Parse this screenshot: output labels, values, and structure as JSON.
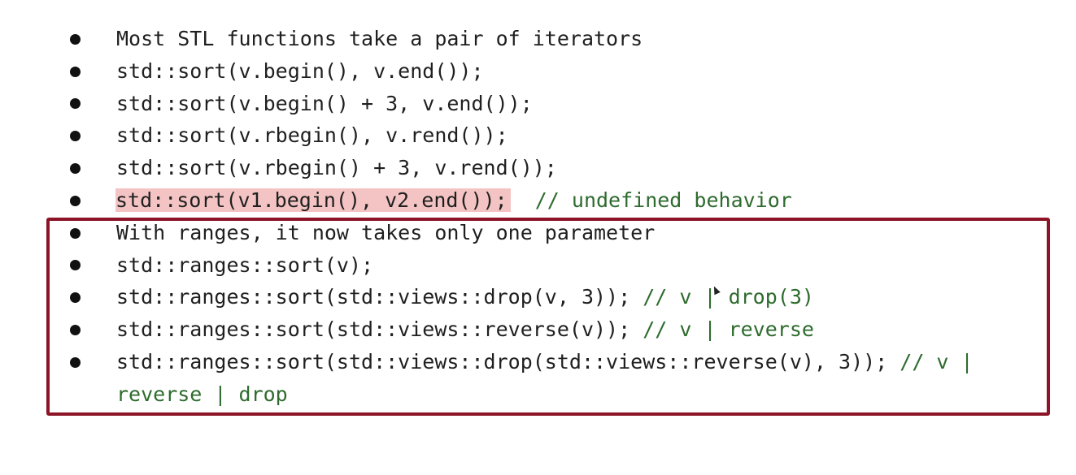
{
  "slide": {
    "lines": [
      {
        "code": "Most STL functions take a pair of iterators",
        "comment": ""
      },
      {
        "code": "std::sort(v.begin(), v.end());",
        "comment": ""
      },
      {
        "code": "std::sort(v.begin() + 3, v.end());",
        "comment": ""
      },
      {
        "code": "std::sort(v.rbegin(), v.rend());",
        "comment": ""
      },
      {
        "code": "std::sort(v.rbegin() + 3, v.rend());",
        "comment": ""
      },
      {
        "code": "std::sort(v1.begin(), v2.end());",
        "comment": "  // undefined behavior"
      },
      {
        "code": "With ranges, it now takes only one parameter",
        "comment": ""
      },
      {
        "code": "std::ranges::sort(v);",
        "comment": ""
      },
      {
        "code": "std::ranges::sort(std::views::drop(v, 3)); ",
        "comment": "// v | drop(3)"
      },
      {
        "code": "std::ranges::sort(std::views::reverse(v)); ",
        "comment": "// v | reverse"
      },
      {
        "code": "std::ranges::sort(std::views::drop(std::views::reverse(v), 3)); ",
        "comment": "// v |"
      },
      {
        "code": "",
        "comment": "reverse | drop"
      }
    ]
  },
  "colors": {
    "frame": "#8c1426",
    "highlight": "#f4c4c4",
    "comment": "#2e6b2e",
    "text": "#1f1f1f"
  }
}
